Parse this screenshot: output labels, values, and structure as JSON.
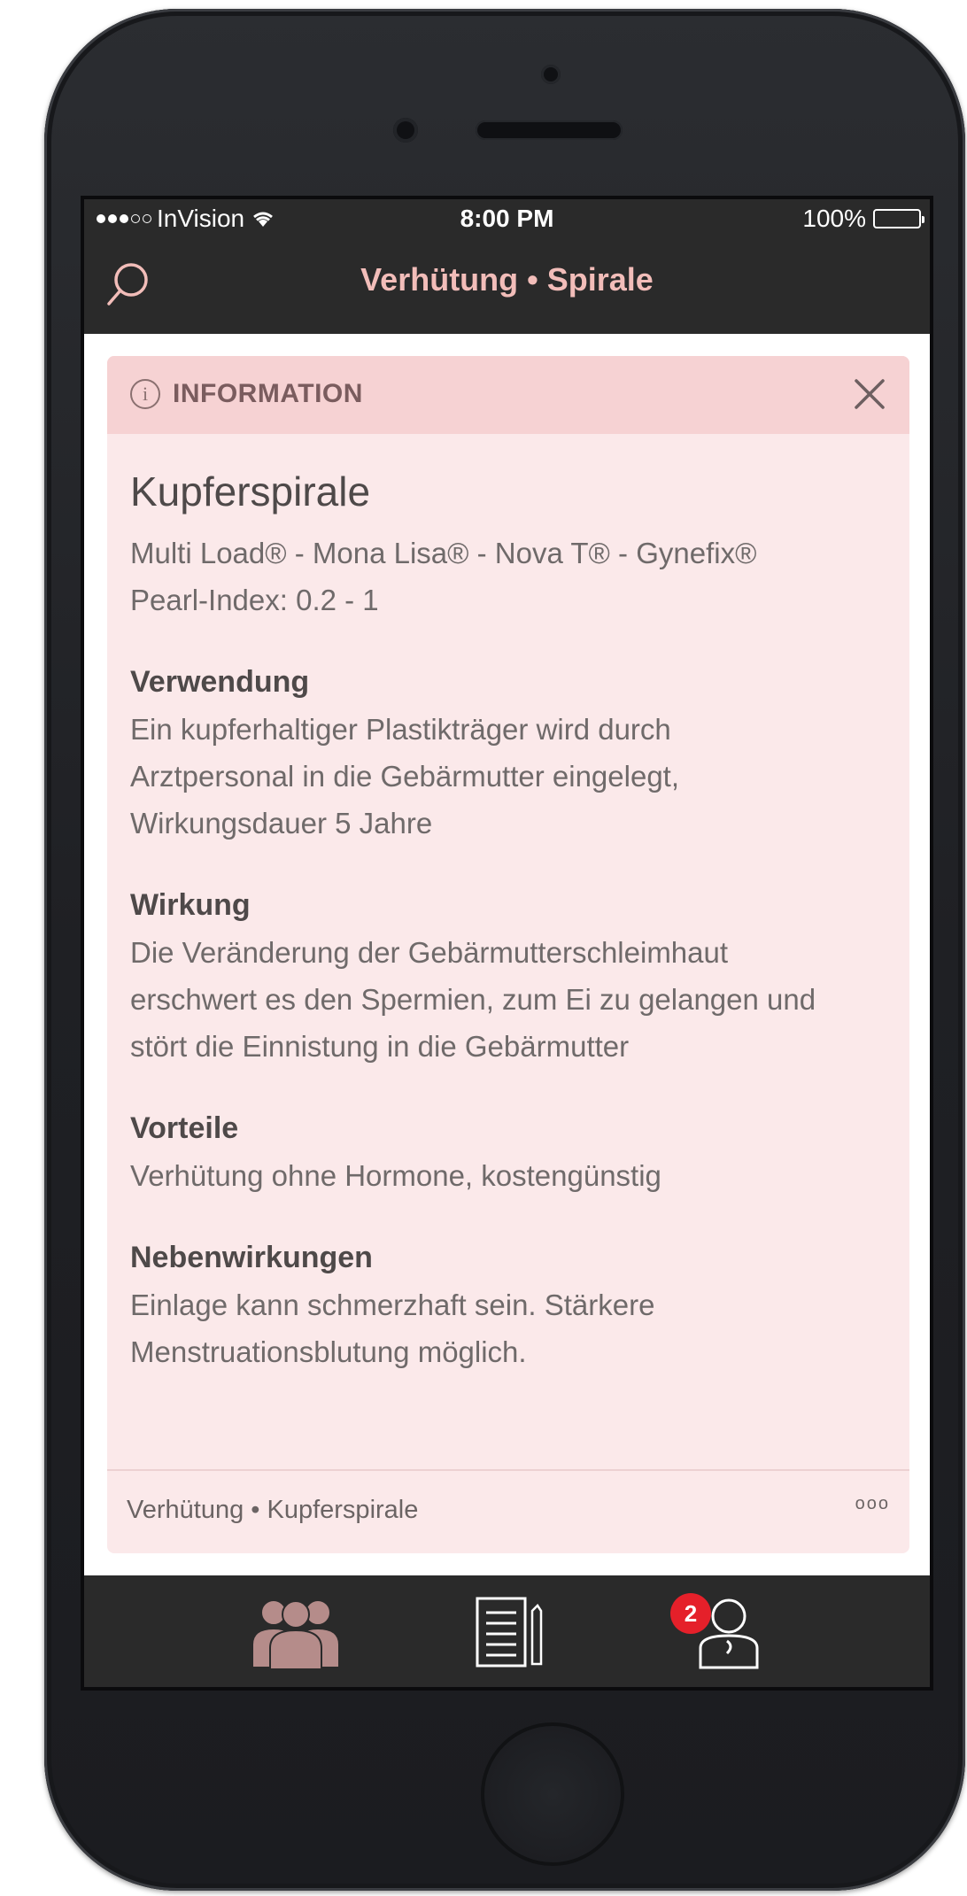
{
  "status_bar": {
    "carrier": "InVision",
    "time": "8:00 PM",
    "battery": "100%"
  },
  "nav": {
    "title": "Verhütung • Spirale"
  },
  "info_card": {
    "header_label": "INFORMATION",
    "info_glyph": "i",
    "title": "Kupferspirale",
    "brands": "Multi Load® - Mona Lisa® - Nova T® - Gynefix®",
    "pearl_index": "Pearl-Index: 0.2 - 1",
    "sections": [
      {
        "heading": "Verwendung",
        "lines": [
          "Ein kupferhaltiger Plastikträger wird durch",
          "Arztpersonal in die Gebärmutter eingelegt,",
          "Wirkungsdauer 5 Jahre"
        ]
      },
      {
        "heading": "Wirkung",
        "lines": [
          "Die Veränderung der Gebärmutterschleimhaut",
          "erschwert es den Spermien, zum Ei zu gelangen und",
          "stört die Einnistung in die Gebärmutter"
        ]
      },
      {
        "heading": "Vorteile",
        "lines": [
          "Verhütung ohne Hormone, kostengünstig"
        ]
      },
      {
        "heading": "Nebenwirkungen",
        "lines": [
          "Einlage kann schmerzhaft sein. Stärkere",
          "Menstruationsblutung möglich."
        ]
      }
    ],
    "footer_breadcrumb": "Verhütung • Kupferspirale",
    "more_label": "ooo"
  },
  "tab_bar": {
    "icons": [
      "community-icon",
      "notes-icon",
      "profile-icon"
    ],
    "profile_badge": "2"
  },
  "colors": {
    "bar_background": "#2a2a2a",
    "title_pink": "#f2bdb9",
    "card_background": "#fbe9ea",
    "card_header": "#f6d2d3",
    "badge_red": "#e5202a"
  }
}
